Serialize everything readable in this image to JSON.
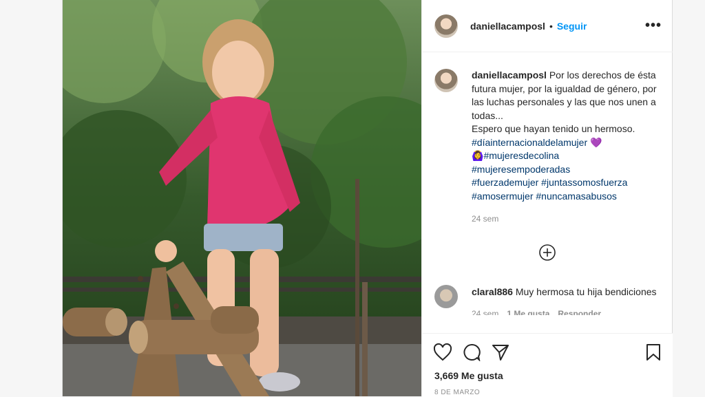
{
  "post": {
    "username": "daniellacamposl",
    "separator": "•",
    "follow_label": "Seguir",
    "more_label": "•••",
    "photo_alt": "Niña con camiseta rosa subiendo a un juego de troncos en un parque",
    "caption": {
      "username": "daniellacamposl",
      "line1": "Por los derechos de ésta futura mujer, por la igualdad de género, por las luchas personales y las que nos unen a todas...",
      "line2": "Espero que hayan tenido un hermoso.",
      "tags": [
        "#díainternacionaldelamujer",
        "#mujeresdecolina",
        "#mujeresempoderadas",
        "#fuerzademujer",
        "#juntassomosfuerza",
        "#amosermujer",
        "#nuncamasabusos"
      ],
      "emoji1": "💜",
      "emoji2": "🙆‍♀️",
      "time": "24 sem"
    },
    "comment": {
      "username": "claral886",
      "text": "Muy hermosa tu hija bendiciones",
      "time": "24 sem",
      "likes": "1 Me gusta",
      "reply": "Responder"
    },
    "likes_count": "3,669 Me gusta",
    "date": "8 DE MARZO"
  },
  "icons": [
    "heart-icon",
    "comment-icon",
    "share-icon",
    "bookmark-icon",
    "add-circle-icon"
  ],
  "colors": {
    "link": "#0095f6",
    "hashtag": "#00376b",
    "muted": "#8e8e8e",
    "shirt": "#e0356f"
  }
}
